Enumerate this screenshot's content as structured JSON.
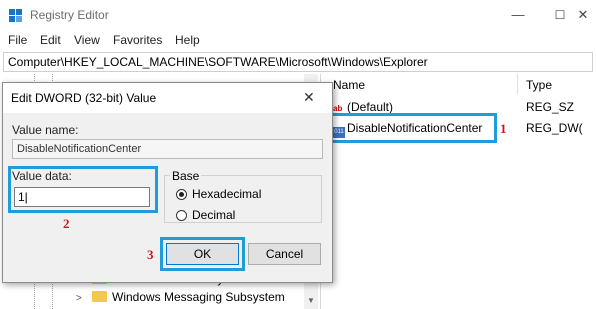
{
  "window": {
    "title": "Registry Editor",
    "minimize": "—",
    "maximize": "☐",
    "close": "✕"
  },
  "menu": [
    "File",
    "Edit",
    "View",
    "Favorites",
    "Help"
  ],
  "address": "Computer\\HKEY_LOCAL_MACHINE\\SOFTWARE\\Microsoft\\Windows\\Explorer",
  "tree": {
    "items": [
      "Windows Media Player NSS",
      "Windows Messaging Subsystem"
    ]
  },
  "list": {
    "col_name": "Name",
    "col_type": "Type",
    "rows": [
      {
        "name": "(Default)",
        "type": "REG_SZ",
        "icon": "string-value-icon"
      },
      {
        "name": "DisableNotificationCenter",
        "type": "REG_DW(",
        "icon": "dword-value-icon"
      }
    ]
  },
  "dialog": {
    "title": "Edit DWORD (32-bit) Value",
    "value_name_label": "Value name:",
    "value_name": "DisableNotificationCenter",
    "value_data_label": "Value data:",
    "value_data": "1|",
    "base_label": "Base",
    "radio_hex": "Hexadecimal",
    "radio_dec": "Decimal",
    "selected_base": "Hexadecimal",
    "ok": "OK",
    "cancel": "Cancel"
  },
  "markers": {
    "one": "1",
    "two": "2",
    "three": "3"
  },
  "colors": {
    "highlight": "#1e9cdc",
    "marker": "#d0141c",
    "folder": "#f2c94c"
  }
}
